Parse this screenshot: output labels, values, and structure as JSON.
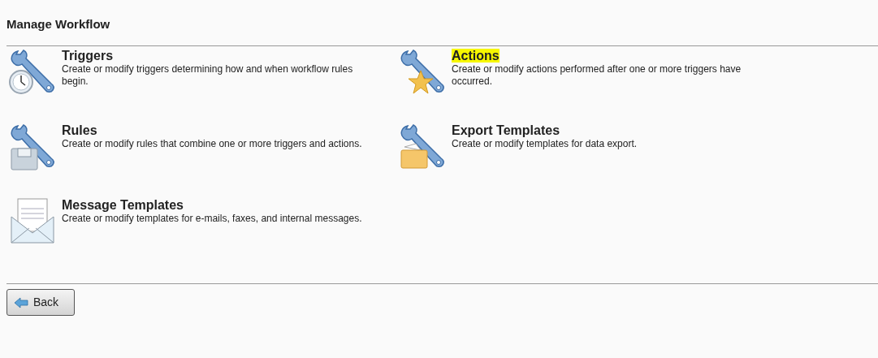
{
  "page": {
    "title": "Manage Workflow"
  },
  "items": [
    {
      "kind": "clock",
      "title": "Triggers",
      "description": "Create or modify triggers determining how and when workflow rules begin.",
      "highlighted": false
    },
    {
      "kind": "star",
      "title": "Actions",
      "description": "Create or modify actions performed after one or more triggers have occurred.",
      "highlighted": true
    },
    {
      "kind": "disk",
      "title": "Rules",
      "description": "Create or modify rules that combine one or more triggers and actions.",
      "highlighted": false
    },
    {
      "kind": "folder",
      "title": "Export Templates",
      "description": "Create or modify templates for data export.",
      "highlighted": false
    },
    {
      "kind": "envelope",
      "title": "Message Templates",
      "description": "Create or modify templates for e-mails, faxes, and internal messages.",
      "highlighted": false
    }
  ],
  "back_button": {
    "label": "Back"
  }
}
